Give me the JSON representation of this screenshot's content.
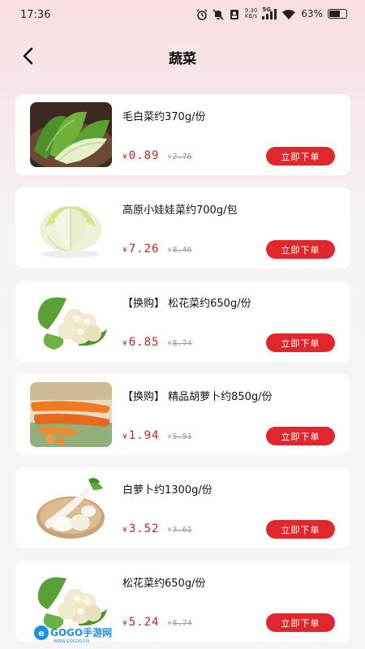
{
  "status_bar": {
    "time": "17:36",
    "net_speed_value": "9.30",
    "net_speed_unit": "KB/s",
    "network_type": "5G",
    "battery_percent": "63%",
    "battery_level": 0.63,
    "icons": [
      "alarm-icon",
      "mute-icon",
      "sim-icon",
      "signal-icon",
      "wifi-icon",
      "battery-icon"
    ]
  },
  "header": {
    "back_icon": "chevron-left-icon",
    "title": "蔬菜"
  },
  "colors": {
    "accent": "#e0272e",
    "price": "#c5232b",
    "original_price": "#999999",
    "card_bg": "#ffffff"
  },
  "currency_symbol": "¥",
  "buy_label": "立即下单",
  "products": [
    {
      "name": "毛白菜约370g/份",
      "price": "0.89",
      "original_price": "2.76",
      "image": "napa-cabbage-leaves"
    },
    {
      "name": "高原小娃娃菜约700g/包",
      "price": "7.26",
      "original_price": "8.46",
      "image": "baby-cabbage"
    },
    {
      "name": "【换购】 松花菜约650g/份",
      "price": "6.85",
      "original_price": "8.74",
      "image": "cauliflower"
    },
    {
      "name": "【换购】 精品胡萝卜约850g/份",
      "price": "1.94",
      "original_price": "5.51",
      "image": "carrots"
    },
    {
      "name": "白萝卜约1300g/份",
      "price": "3.52",
      "original_price": "3.61",
      "image": "white-radish"
    },
    {
      "name": "松花菜约650g/份",
      "price": "5.24",
      "original_price": "8.74",
      "image": "cauliflower"
    }
  ],
  "watermark": {
    "logo_text": "GOGO手游网",
    "url_text": "WWW.GOGOO.CN"
  }
}
